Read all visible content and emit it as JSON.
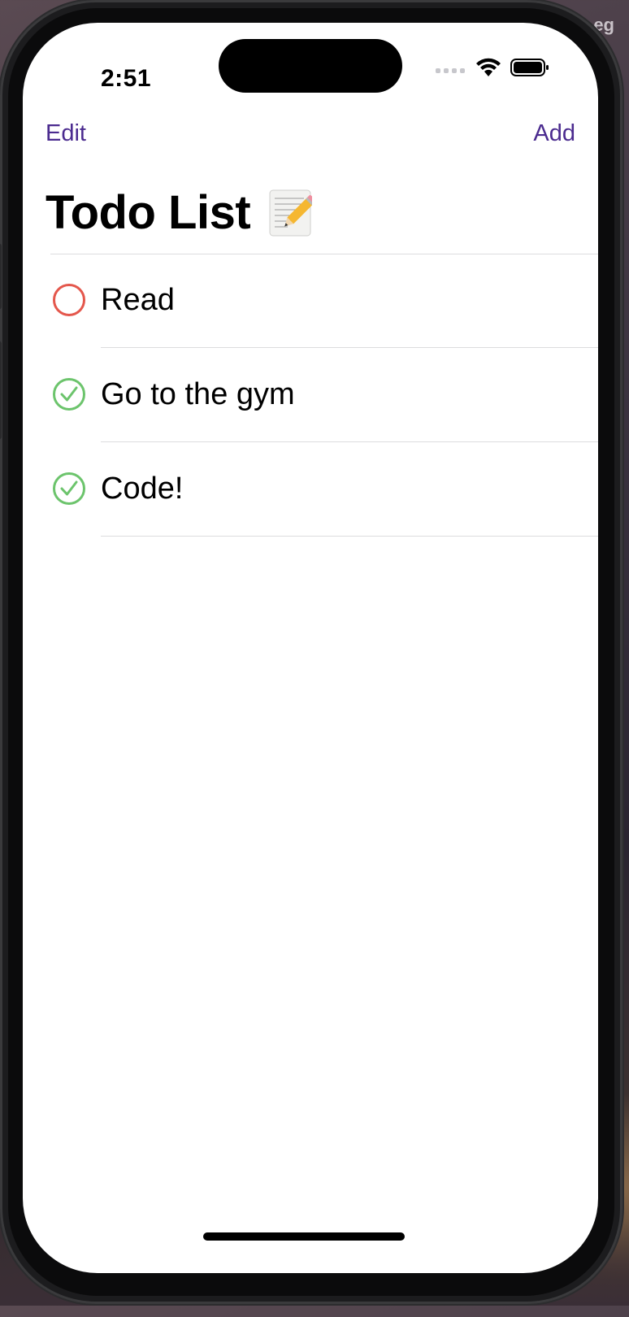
{
  "status_bar": {
    "time": "2:51"
  },
  "nav": {
    "edit_label": "Edit",
    "add_label": "Add"
  },
  "title": "Todo List",
  "title_icon": "memo-emoji-icon",
  "todos": [
    {
      "label": "Read",
      "done": false,
      "icon": "circle-outline-icon"
    },
    {
      "label": "Go to the gym",
      "done": true,
      "icon": "check-circle-icon"
    },
    {
      "label": "Code!",
      "done": true,
      "icon": "check-circle-icon"
    }
  ],
  "colors": {
    "accent": "#4b2b8f",
    "incomplete": "#e4574c",
    "complete": "#6cc46c",
    "separator": "#dcdcde"
  },
  "desktop": {
    "corner_text": "eg"
  }
}
